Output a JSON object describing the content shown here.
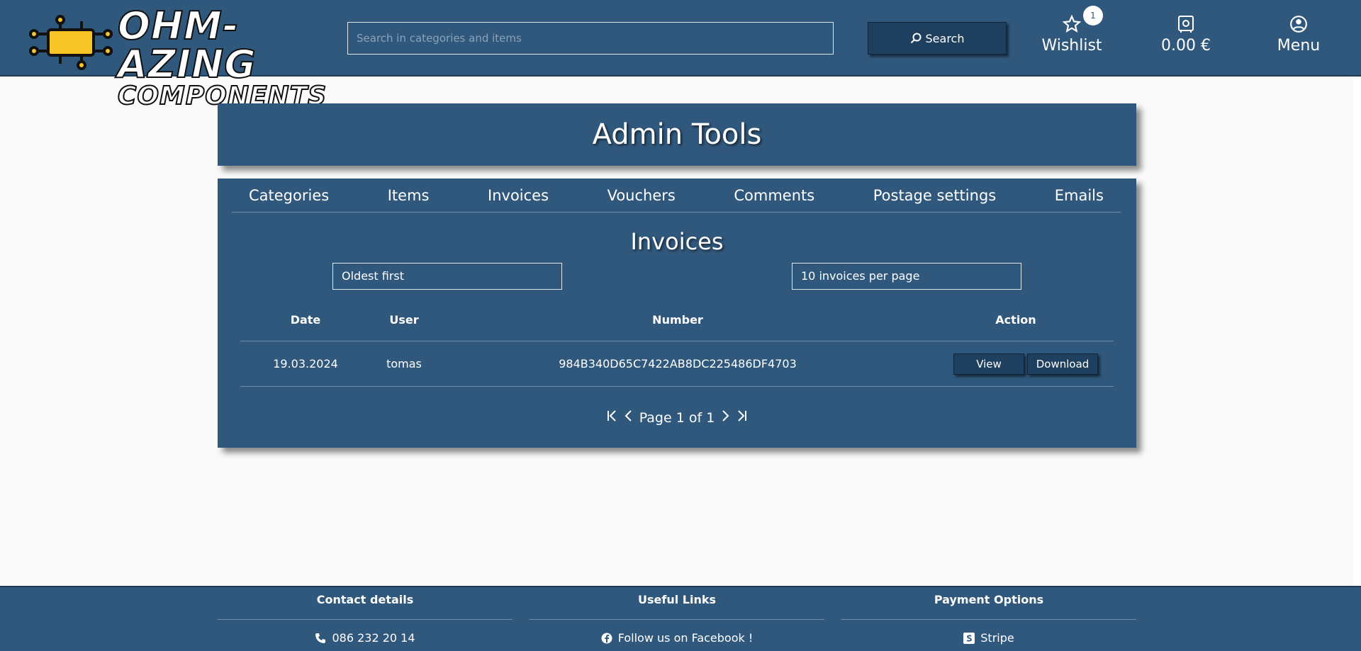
{
  "header": {
    "logo_line1": "OHM-AZING",
    "logo_line2": "COMPONENTS",
    "search_placeholder": "Search in categories and items",
    "search_button": "Search",
    "wishlist_label": "Wishlist",
    "wishlist_count": "1",
    "cart_total": "0.00 €",
    "menu_label": "Menu"
  },
  "admin": {
    "title": "Admin Tools",
    "tabs": [
      "Categories",
      "Items",
      "Invoices",
      "Vouchers",
      "Comments",
      "Postage settings",
      "Emails"
    ],
    "section_title": "Invoices",
    "sort_value": "Oldest first",
    "per_page_value": "10 invoices per page",
    "table": {
      "headers": [
        "Date",
        "User",
        "Number",
        "Action"
      ],
      "rows": [
        {
          "date": "19.03.2024",
          "user": "tomas",
          "number": "984B340D65C7422AB8DC225486DF4703",
          "view": "View",
          "download": "Download"
        }
      ]
    },
    "pager_text": "Page 1 of 1"
  },
  "footer": {
    "contact_title": "Contact details",
    "phone": "086 232 20 14",
    "links_title": "Useful Links",
    "facebook": "Follow us on Facebook !",
    "payment_title": "Payment Options",
    "payment_provider": "Stripe"
  },
  "colors": {
    "primary": "#30587c",
    "dark": "#1f3f5e",
    "logo_chip": "#f7c526"
  }
}
